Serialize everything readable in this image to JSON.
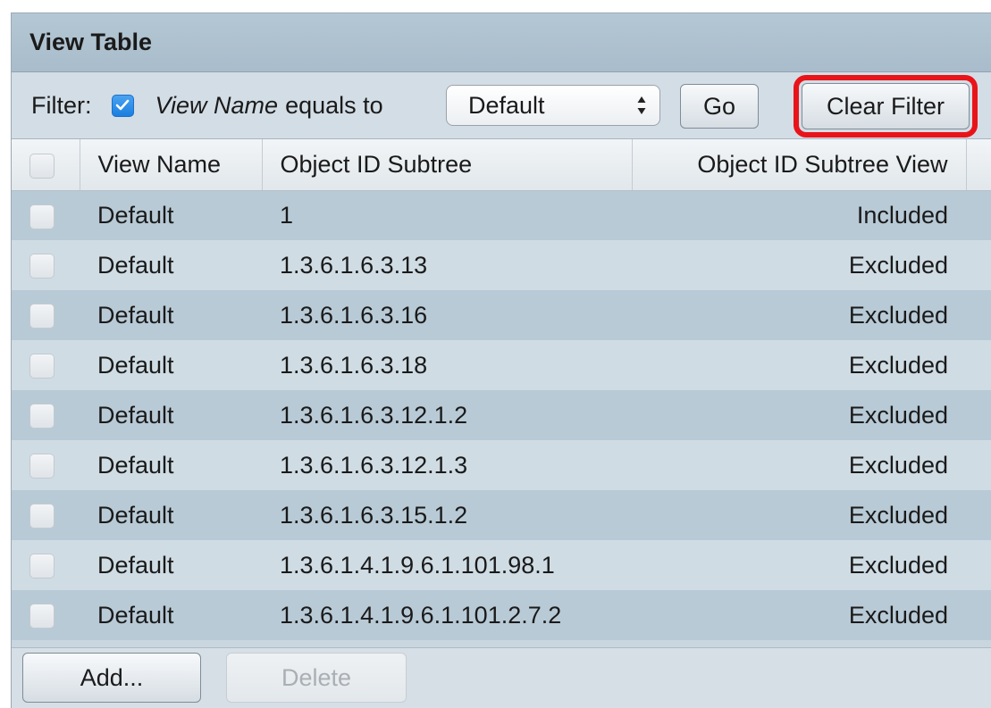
{
  "title": "View Table",
  "filter": {
    "label": "Filter:",
    "checked": true,
    "field": "View Name",
    "operator": "equals to",
    "selected": "Default",
    "go_label": "Go",
    "clear_label": "Clear Filter"
  },
  "columns": [
    "View Name",
    "Object ID Subtree",
    "Object ID Subtree View"
  ],
  "rows": [
    {
      "view_name": "Default",
      "subtree": "1",
      "type": "Included"
    },
    {
      "view_name": "Default",
      "subtree": "1.3.6.1.6.3.13",
      "type": "Excluded"
    },
    {
      "view_name": "Default",
      "subtree": "1.3.6.1.6.3.16",
      "type": "Excluded"
    },
    {
      "view_name": "Default",
      "subtree": "1.3.6.1.6.3.18",
      "type": "Excluded"
    },
    {
      "view_name": "Default",
      "subtree": "1.3.6.1.6.3.12.1.2",
      "type": "Excluded"
    },
    {
      "view_name": "Default",
      "subtree": "1.3.6.1.6.3.12.1.3",
      "type": "Excluded"
    },
    {
      "view_name": "Default",
      "subtree": "1.3.6.1.6.3.15.1.2",
      "type": "Excluded"
    },
    {
      "view_name": "Default",
      "subtree": "1.3.6.1.4.1.9.6.1.101.98.1",
      "type": "Excluded"
    },
    {
      "view_name": "Default",
      "subtree": "1.3.6.1.4.1.9.6.1.101.2.7.2",
      "type": "Excluded"
    }
  ],
  "footer": {
    "add_label": "Add...",
    "delete_label": "Delete"
  },
  "colors": {
    "highlight": "#e8141a",
    "checkbox_accent": "#1a7fe0"
  }
}
